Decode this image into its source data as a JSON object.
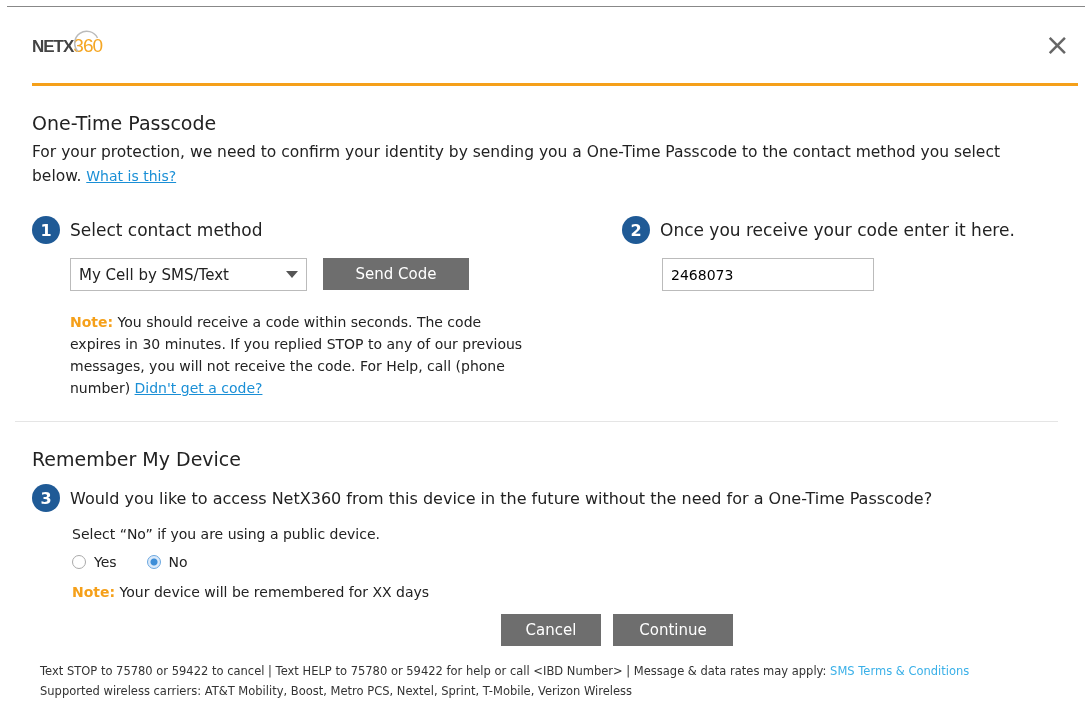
{
  "header": {
    "logo": {
      "main": "NETX",
      "accent": "360"
    },
    "close": "×"
  },
  "passcode": {
    "title": "One-Time Passcode",
    "intro": "For your protection, we need to confirm your identity by sending you a One-Time Passcode to the contact method you select below.",
    "help_link": "What is this?",
    "step1": {
      "number": "1",
      "label": "Select contact method",
      "select_value": "My Cell by SMS/Text",
      "button": "Send Code",
      "note": {
        "label": "Note:",
        "text": "You should receive a code  within seconds.  The code expires in 30 minutes. If you replied STOP to any of our previous messages, you will not receive the code.  For Help, call (phone number)",
        "link": "Didn't get a code?"
      }
    },
    "step2": {
      "number": "2",
      "label": "Once you receive your code enter it here.",
      "value": "2468073"
    }
  },
  "remember": {
    "title": "Remember My Device",
    "number": "3",
    "question": "Would you like to access NetX360 from this device in the future without the need for a One-Time Passcode?",
    "hint": "Select “No” if you are using a public device.",
    "options": [
      {
        "label": "Yes",
        "selected": false
      },
      {
        "label": "No",
        "selected": true
      }
    ],
    "note": {
      "label": "Note:",
      "text": "Your device will be remembered for XX days"
    }
  },
  "buttons": [
    "Cancel",
    "Continue"
  ],
  "footer": {
    "line1": "Text STOP to 75780 or 59422 to cancel | Text HELP to 75780 or 59422 for help or call <IBD Number> | Message & data rates may apply:",
    "terms_link": "SMS Terms & Conditions",
    "line2": "Supported wireless carriers: AT&T Mobility, Boost, Metro PCS, Nextel, Sprint, T-Mobile, Verizon Wireless"
  }
}
